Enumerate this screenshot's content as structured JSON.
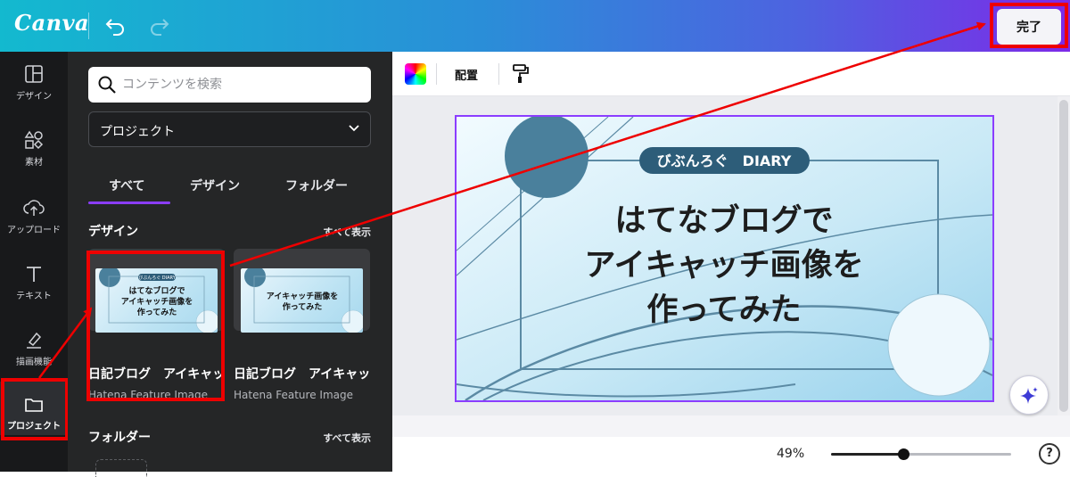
{
  "header": {
    "logo": "Canva",
    "done_label": "完了"
  },
  "rail": [
    {
      "label": "デザイン",
      "icon": "layout-icon"
    },
    {
      "label": "素材",
      "icon": "elements-icon"
    },
    {
      "label": "アップロード",
      "icon": "upload-icon"
    },
    {
      "label": "テキスト",
      "icon": "text-icon"
    },
    {
      "label": "描画機能",
      "icon": "draw-icon"
    },
    {
      "label": "プロジェクト",
      "icon": "folder-icon"
    }
  ],
  "panel": {
    "search_placeholder": "コンテンツを検索",
    "select_value": "プロジェクト",
    "tabs": [
      "すべて",
      "デザイン",
      "フォルダー"
    ],
    "designs_title": "デザイン",
    "show_all": "すべて表示",
    "cards": [
      {
        "title": "日記ブログ　アイキャッチ",
        "subtitle": "Hatena Feature Image",
        "thumb_badge": "びぶんろぐ DIARY",
        "thumb_text": [
          "はてなブログで",
          "アイキャッチ画像を",
          "作ってみた"
        ]
      },
      {
        "title": "日記ブログ　アイキャッチ",
        "subtitle": "Hatena Feature Image",
        "thumb_badge": "",
        "thumb_text": [
          "アイキャッチ画像を",
          "作ってみた"
        ]
      }
    ],
    "folders_title": "フォルダー",
    "folders_show_all": "すべて表示"
  },
  "toolbar": {
    "arrange_label": "配置"
  },
  "design": {
    "badge": "びぶんろぐ　DIARY",
    "lines": [
      "はてなブログで",
      "アイキャッチ画像を",
      "作ってみた"
    ]
  },
  "footer": {
    "zoom": "49%",
    "zoom_level": 0.4,
    "help": "?"
  }
}
